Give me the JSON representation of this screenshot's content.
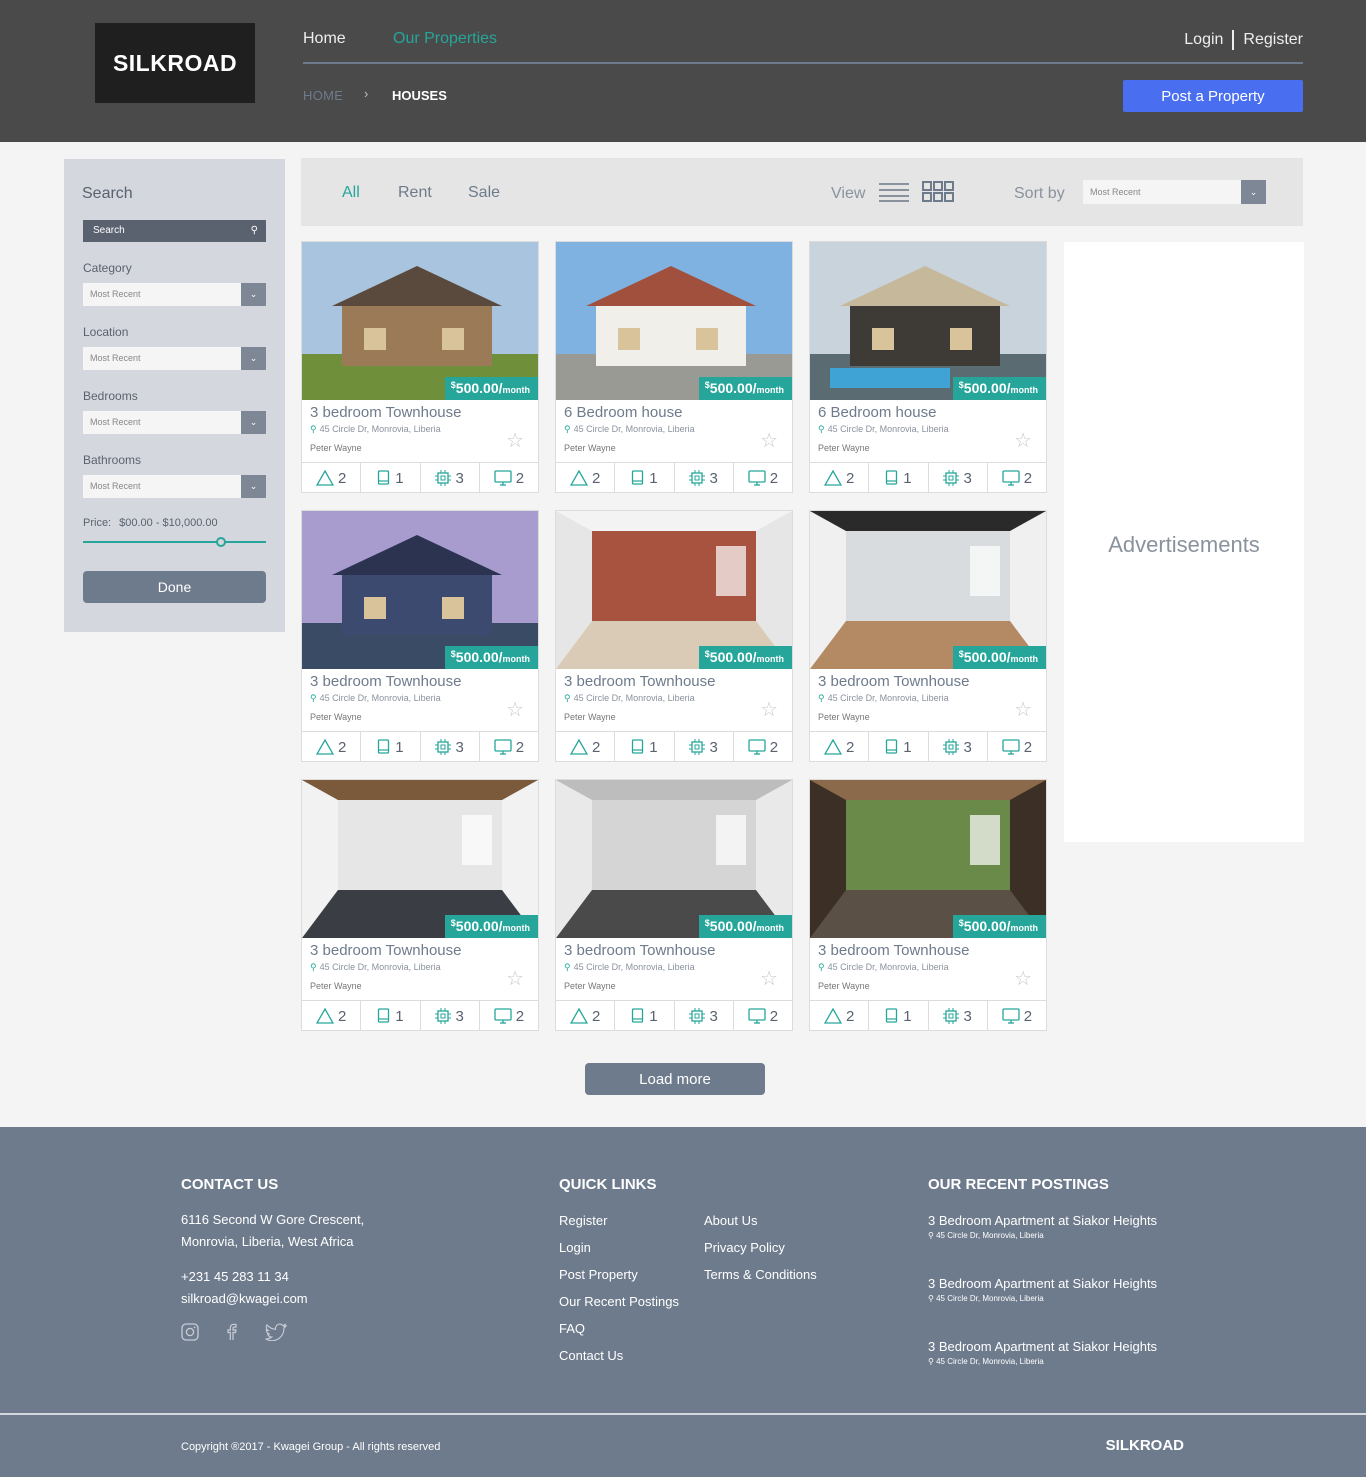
{
  "header": {
    "brand": "SILKROAD",
    "nav": {
      "home": "Home",
      "properties": "Our Properties"
    },
    "auth": {
      "login": "Login",
      "register": "Register"
    },
    "breadcrumb": {
      "home": "HOME",
      "separator": "›",
      "current": "HOUSES"
    },
    "post_button": "Post a Property"
  },
  "sidebar": {
    "title": "Search",
    "search_placeholder": "Search",
    "filters": [
      {
        "label": "Category",
        "value": "Most Recent"
      },
      {
        "label": "Location",
        "value": "Most Recent"
      },
      {
        "label": "Bedrooms",
        "value": "Most Recent"
      },
      {
        "label": "Bathrooms",
        "value": "Most Recent"
      }
    ],
    "price_label": "Price:",
    "price_range": "$00.00 - $10,000.00",
    "price_slider_fraction": 0.75,
    "done_button": "Done"
  },
  "toolbar": {
    "tabs": [
      "All",
      "Rent",
      "Sale"
    ],
    "active_tab": "All",
    "view_label": "View",
    "sort_label": "Sort by",
    "sort_value": "Most Recent"
  },
  "listings": [
    {
      "title": "3 bedroom Townhouse",
      "address": "45 Circle Dr, Monrovia, Liberia",
      "owner": "Peter Wayne",
      "price": "500.00",
      "stats": [
        "2",
        "1",
        "3",
        "2"
      ]
    },
    {
      "title": "6 Bedroom house",
      "address": "45 Circle Dr, Monrovia, Liberia",
      "owner": "Peter Wayne",
      "price": "500.00",
      "stats": [
        "2",
        "1",
        "3",
        "2"
      ]
    },
    {
      "title": "6 Bedroom house",
      "address": "45 Circle Dr, Monrovia, Liberia",
      "owner": "Peter Wayne",
      "price": "500.00",
      "stats": [
        "2",
        "1",
        "3",
        "2"
      ]
    },
    {
      "title": "3 bedroom Townhouse",
      "address": "45 Circle Dr, Monrovia, Liberia",
      "owner": "Peter Wayne",
      "price": "500.00",
      "stats": [
        "2",
        "1",
        "3",
        "2"
      ]
    },
    {
      "title": "3 bedroom Townhouse",
      "address": "45 Circle Dr, Monrovia, Liberia",
      "owner": "Peter Wayne",
      "price": "500.00",
      "stats": [
        "2",
        "1",
        "3",
        "2"
      ]
    },
    {
      "title": "3 bedroom Townhouse",
      "address": "45 Circle Dr, Monrovia, Liberia",
      "owner": "Peter Wayne",
      "price": "500.00",
      "stats": [
        "2",
        "1",
        "3",
        "2"
      ]
    },
    {
      "title": "3 bedroom Townhouse",
      "address": "45 Circle Dr, Monrovia, Liberia",
      "owner": "Peter Wayne",
      "price": "500.00",
      "stats": [
        "2",
        "1",
        "3",
        "2"
      ]
    },
    {
      "title": "3 bedroom Townhouse",
      "address": "45 Circle Dr, Monrovia, Liberia",
      "owner": "Peter Wayne",
      "price": "500.00",
      "stats": [
        "2",
        "1",
        "3",
        "2"
      ]
    },
    {
      "title": "3 bedroom Townhouse",
      "address": "45 Circle Dr, Monrovia, Liberia",
      "owner": "Peter Wayne",
      "price": "500.00",
      "stats": [
        "2",
        "1",
        "3",
        "2"
      ]
    }
  ],
  "price_format": {
    "currency": "$",
    "suffix": "/",
    "period": "month"
  },
  "ads_label": "Advertisements",
  "load_more": "Load more",
  "footer": {
    "contact": {
      "heading": "CONTACT US",
      "address_line1": "6116 Second W Gore Crescent,",
      "address_line2": "Monrovia, Liberia, West Africa",
      "phone": "+231 45 283 11 34",
      "email": "silkroad@kwagei.com"
    },
    "quick_links": {
      "heading": "QUICK LINKS",
      "col1": [
        "Register",
        "Login",
        "Post Property",
        "Our Recent Postings",
        "FAQ",
        "Contact Us"
      ],
      "col2": [
        "About Us",
        "Privacy Policy",
        "Terms & Conditions"
      ]
    },
    "recent": {
      "heading": "OUR RECENT POSTINGS",
      "items": [
        {
          "title": "3 Bedroom Apartment at Siakor Heights",
          "address": "45 Circle Dr, Monrovia, Liberia"
        },
        {
          "title": "3 Bedroom Apartment at Siakor Heights",
          "address": "45 Circle Dr, Monrovia, Liberia"
        },
        {
          "title": "3 Bedroom Apartment at Siakor Heights",
          "address": "45 Circle Dr, Monrovia, Liberia"
        }
      ]
    },
    "copyright": "Copyright ®2017 - Kwagei Group - All rights reserved",
    "brand": "SILKROAD"
  },
  "colors": {
    "accent": "#26a69a",
    "primary_button": "#4a6ef0",
    "header_bg": "#4a4a4a",
    "footer_bg": "#6e7b8c"
  },
  "icons": {
    "search": "search-icon",
    "pin": "map-pin-icon",
    "star": "star-icon",
    "beds": "triangle-icon",
    "baths": "book-icon",
    "rooms": "chip-icon",
    "tv": "monitor-icon"
  }
}
